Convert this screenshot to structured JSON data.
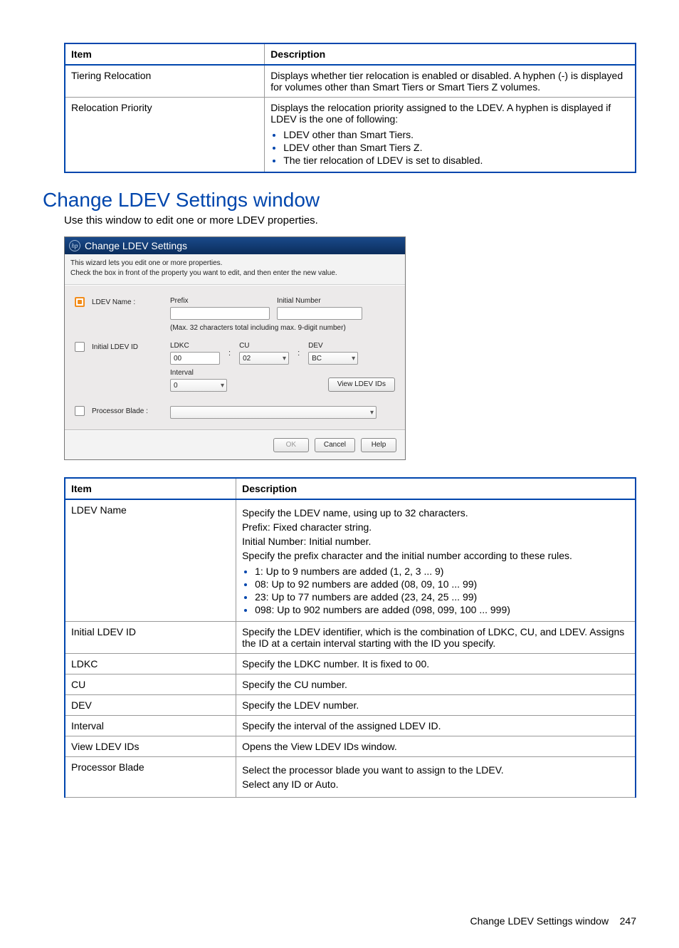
{
  "top_table": {
    "headers": {
      "item": "Item",
      "description": "Description"
    },
    "rows": {
      "tiering_relocation": {
        "item": "Tiering Relocation",
        "desc": "Displays whether tier relocation is enabled or disabled. A hyphen (-) is displayed for volumes other than Smart Tiers or Smart Tiers Z volumes."
      },
      "relocation_priority": {
        "item": "Relocation Priority",
        "desc": "Displays the relocation priority assigned to the LDEV. A hyphen is displayed if LDEV is the one of following:",
        "bullets": {
          "b1": "LDEV other than Smart Tiers.",
          "b2": "LDEV other than Smart Tiers Z.",
          "b3": "The tier relocation of LDEV is set to disabled."
        }
      }
    }
  },
  "section": {
    "heading": "Change LDEV Settings window",
    "intro": "Use this window to edit one or more LDEV properties."
  },
  "dialog": {
    "title": "Change LDEV Settings",
    "help1": "This wizard lets you edit one or more properties.",
    "help2": "Check the  box in front of the property you want to edit, and then enter the new value.",
    "rows": {
      "ldev_name": {
        "label": "LDEV Name :",
        "prefix_label": "Prefix",
        "initial_number_label": "Initial Number",
        "prefix_value": "",
        "initial_number_value": "",
        "hint": "(Max. 32 characters total including max. 9-digit number)"
      },
      "initial_ldev_id": {
        "label": "Initial LDEV ID",
        "ldkc_label": "LDKC",
        "ldkc_value": "00",
        "cu_label": "CU",
        "cu_value": "02",
        "dev_label": "DEV",
        "dev_value": "BC",
        "interval_label": "Interval",
        "interval_value": "0",
        "view_button": "View LDEV IDs"
      },
      "processor_blade": {
        "label": "Processor Blade :",
        "value": ""
      }
    },
    "footer": {
      "ok": "OK",
      "cancel": "Cancel",
      "help": "Help"
    }
  },
  "desc_table": {
    "headers": {
      "item": "Item",
      "description": "Description"
    },
    "rows": {
      "ldev_name": {
        "item": "LDEV Name",
        "p1": "Specify the LDEV name, using up to 32 characters.",
        "p2": "Prefix: Fixed character string.",
        "p3": "Initial Number: Initial number.",
        "p4": "Specify the prefix character and the initial number according to these rules.",
        "bullets": {
          "b1": "1: Up to 9 numbers are added (1, 2, 3 ... 9)",
          "b2": "08: Up to 92 numbers are added (08, 09, 10 ... 99)",
          "b3": "23: Up to 77 numbers are added (23, 24, 25 ... 99)",
          "b4": "098: Up to 902 numbers are added (098, 099, 100 ... 999)"
        }
      },
      "initial_ldev_id": {
        "item": "Initial LDEV ID",
        "desc": "Specify the LDEV identifier, which is the combination of LDKC, CU, and LDEV. Assigns the ID at a certain interval starting with the ID you specify."
      },
      "ldkc": {
        "item": "LDKC",
        "desc": "Specify the LDKC number. It is fixed to 00."
      },
      "cu": {
        "item": "CU",
        "desc": "Specify the CU number."
      },
      "dev": {
        "item": "DEV",
        "desc": "Specify the LDEV number."
      },
      "interval": {
        "item": "Interval",
        "desc": "Specify the interval of the assigned LDEV ID."
      },
      "view_ldev_ids": {
        "item": "View LDEV IDs",
        "desc": "Opens the View LDEV IDs window."
      },
      "processor_blade": {
        "item": "Processor Blade",
        "p1": "Select the processor blade you want to assign to the LDEV.",
        "p2": "Select any ID or Auto."
      }
    }
  },
  "footer": {
    "text": "Change LDEV Settings window",
    "page": "247"
  }
}
